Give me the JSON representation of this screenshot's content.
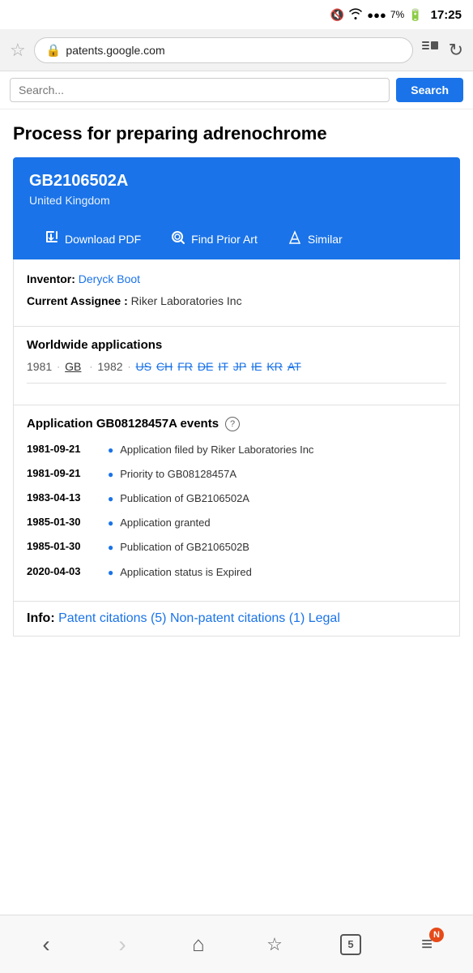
{
  "statusBar": {
    "time": "17:25",
    "battery": "7%",
    "signal": "●●●",
    "wifi": "WiFi"
  },
  "browser": {
    "url": "patents.google.com",
    "star_label": "☆",
    "lock_label": "🔒",
    "tabs_label": "≡",
    "refresh_label": "↻"
  },
  "page": {
    "title": "Process for preparing adrenochrome",
    "patent": {
      "number": "GB2106502A",
      "country": "United Kingdom",
      "actions": {
        "download": "Download PDF",
        "prior_art": "Find Prior Art",
        "similar": "Similar"
      }
    },
    "inventor_label": "Inventor:",
    "inventor_name": "Deryck Boot",
    "assignee_label": "Current Assignee :",
    "assignee_value": "Riker Laboratories Inc",
    "worldwide_title": "Worldwide applications",
    "apps_1981_year": "1981",
    "apps_1981_current": "GB",
    "apps_1982_year": "1982",
    "apps_1982_links": [
      "US",
      "CH",
      "FR",
      "DE",
      "IT",
      "JP",
      "IE",
      "KR",
      "AT"
    ],
    "events_title": "Application GB08128457A events",
    "events": [
      {
        "date": "1981-09-21",
        "desc": "Application filed by Riker Laboratories Inc"
      },
      {
        "date": "1981-09-21",
        "desc": "Priority to GB08128457A"
      },
      {
        "date": "1983-04-13",
        "desc": "Publication of GB2106502A"
      },
      {
        "date": "1985-01-30",
        "desc": "Application granted"
      },
      {
        "date": "1985-01-30",
        "desc": "Publication of GB2106502B"
      },
      {
        "date": "2020-04-03",
        "desc": "Application status is Expired"
      }
    ],
    "info_label": "Info:",
    "info_links": [
      "Patent citations (5)",
      "Non-patent citations (1)",
      "Legal"
    ]
  },
  "bottomNav": {
    "back": "‹",
    "forward": "›",
    "home": "⌂",
    "bookmark": "☆",
    "tabs": "5",
    "menu": "≡",
    "notification_badge": "N"
  }
}
